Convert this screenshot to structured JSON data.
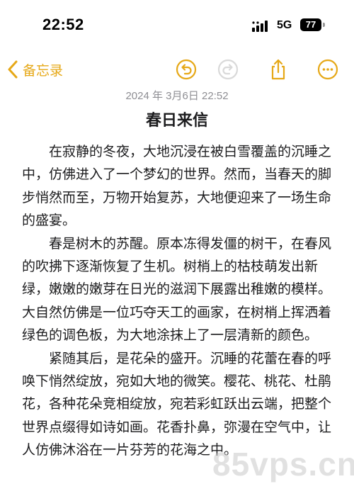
{
  "status_bar": {
    "time": "22:52",
    "network": "5G",
    "battery": "77"
  },
  "toolbar": {
    "back_label": "备忘录",
    "accent_color": "#e6a817",
    "icons": [
      "undo-icon",
      "redo-icon",
      "share-icon",
      "more-icon"
    ]
  },
  "note": {
    "date": "2024 年 3月6日 22:52",
    "title": "春日来信",
    "paragraphs": [
      "在寂静的冬夜，大地沉浸在被白雪覆盖的沉睡之中，仿佛进入了一个梦幻的世界。然而，当春天的脚步悄然而至，万物开始复苏，大地便迎来了一场生命的盛宴。",
      "春是树木的苏醒。原本冻得发僵的树干，在春风的吹拂下逐渐恢复了生机。树梢上的枯枝萌发出新绿，嫩嫩的嫩芽在日光的滋润下展露出稚嫩的模样。大自然仿佛是一位巧夺天工的画家，在树梢上挥洒着绿色的调色板，为大地涂抹上了一层清新的颜色。",
      "紧随其后，是花朵的盛开。沉睡的花蕾在春的呼唤下悄然绽放，宛如大地的微笑。樱花、桃花、杜鹃花，各种花朵竞相绽放，宛若彩虹跃出云端，把整个世界点缀得如诗如画。花香扑鼻，弥漫在空气中，让人仿佛沐浴在一片芬芳的花海之中。"
    ]
  },
  "watermark": "85vps.cn"
}
